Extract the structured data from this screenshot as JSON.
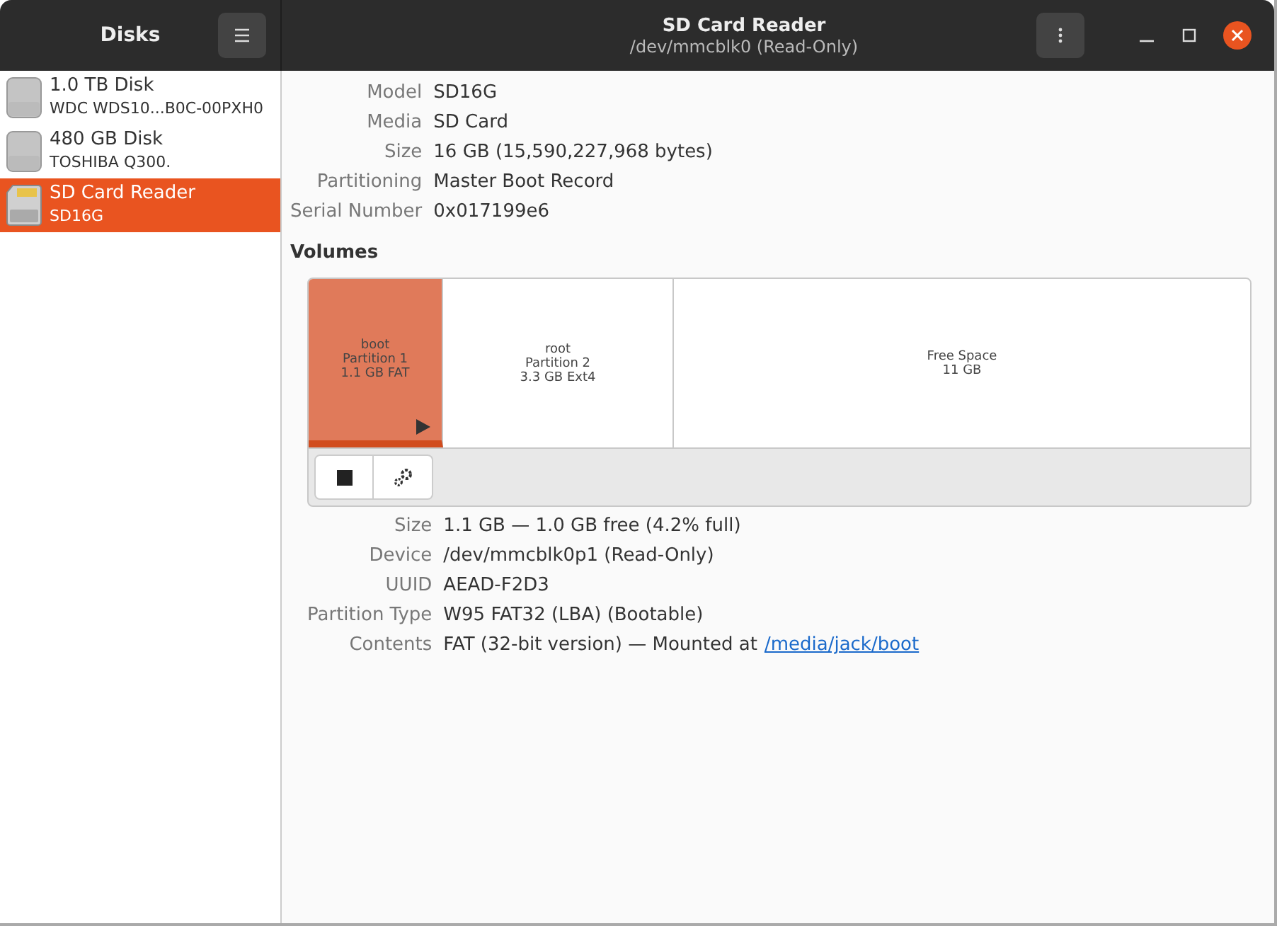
{
  "sidebar": {
    "title": "Disks",
    "items": [
      {
        "kind": "ssd",
        "name": "1.0 TB Disk",
        "model": "WDC WDS10...B0C-00PXH0",
        "selected": false
      },
      {
        "kind": "ssd",
        "name": "480 GB Disk",
        "model": "TOSHIBA Q300.",
        "selected": false
      },
      {
        "kind": "sd",
        "name": "SD Card Reader",
        "model": "SD16G",
        "selected": true
      }
    ]
  },
  "window": {
    "title": "SD Card Reader",
    "subtitle": "/dev/mmcblk0 (Read-Only)"
  },
  "drive_info": [
    {
      "label": "Model",
      "value": "SD16G"
    },
    {
      "label": "Media",
      "value": "SD Card"
    },
    {
      "label": "Size",
      "value": "16 GB (15,590,227,968 bytes)"
    },
    {
      "label": "Partitioning",
      "value": "Master Boot Record"
    },
    {
      "label": "Serial Number",
      "value": "0x017199e6"
    }
  ],
  "volumes": {
    "heading": "Volumes",
    "partitions": [
      {
        "lines": [
          "boot",
          "Partition 1",
          "1.1 GB FAT"
        ],
        "selected": true,
        "mounted": true
      },
      {
        "lines": [
          "root",
          "Partition 2",
          "3.3 GB Ext4"
        ],
        "selected": false,
        "mounted": false
      },
      {
        "lines": [
          "Free Space",
          "11 GB"
        ],
        "selected": false,
        "mounted": false
      }
    ]
  },
  "volume_info": [
    {
      "label": "Size",
      "value": "1.1 GB — 1.0 GB free (4.2% full)"
    },
    {
      "label": "Device",
      "value": "/dev/mmcblk0p1 (Read-Only)"
    },
    {
      "label": "UUID",
      "value": "AEAD-F2D3"
    },
    {
      "label": "Partition Type",
      "value": "W95 FAT32 (LBA) (Bootable)"
    },
    {
      "label": "Contents",
      "value": "FAT (32-bit version) — Mounted at",
      "link": "/media/jack/boot"
    }
  ]
}
